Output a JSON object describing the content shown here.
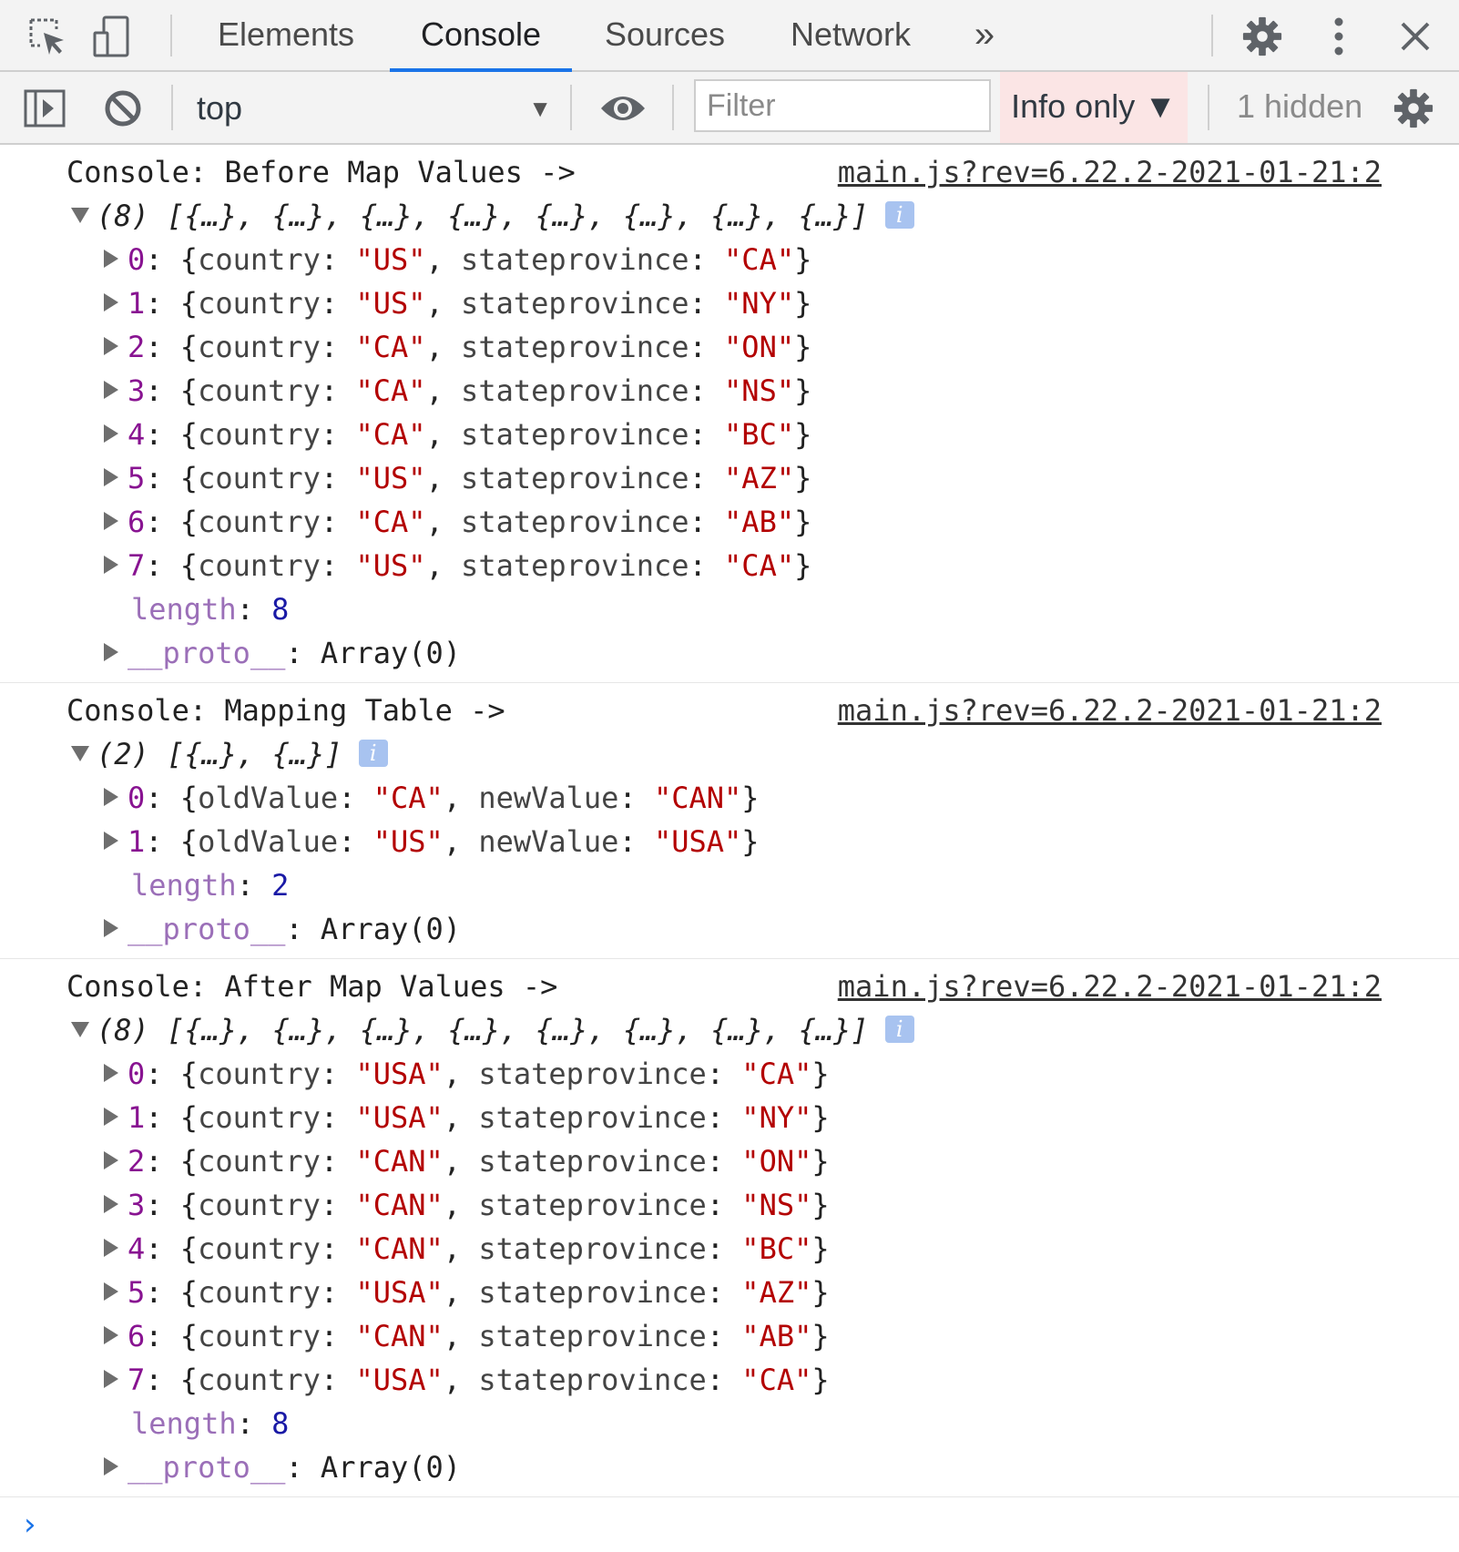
{
  "tabs": {
    "items": [
      "Elements",
      "Console",
      "Sources",
      "Network"
    ],
    "active": "Console",
    "more": "»"
  },
  "toolbar": {
    "context": "top",
    "filter_placeholder": "Filter",
    "levels": "Info only ▼",
    "hidden_count": "1 hidden"
  },
  "messages": [
    {
      "title": "Console: Before Map Values ->",
      "source": "main.js?rev=6.22.2-2021-01-21:2",
      "summary": "(8) [{…}, {…}, {…}, {…}, {…}, {…}, {…}, {…}]",
      "key_a": "country",
      "key_b": "stateprovince",
      "entries": [
        {
          "index": "0",
          "a": "US",
          "b": "CA"
        },
        {
          "index": "1",
          "a": "US",
          "b": "NY"
        },
        {
          "index": "2",
          "a": "CA",
          "b": "ON"
        },
        {
          "index": "3",
          "a": "CA",
          "b": "NS"
        },
        {
          "index": "4",
          "a": "CA",
          "b": "BC"
        },
        {
          "index": "5",
          "a": "US",
          "b": "AZ"
        },
        {
          "index": "6",
          "a": "CA",
          "b": "AB"
        },
        {
          "index": "7",
          "a": "US",
          "b": "CA"
        }
      ],
      "length_label": "length",
      "length": "8",
      "proto_label": "__proto__",
      "proto_value": "Array(0)"
    },
    {
      "title": "Console: Mapping Table ->",
      "source": "main.js?rev=6.22.2-2021-01-21:2",
      "summary": "(2) [{…}, {…}]",
      "key_a": "oldValue",
      "key_b": "newValue",
      "entries": [
        {
          "index": "0",
          "a": "CA",
          "b": "CAN"
        },
        {
          "index": "1",
          "a": "US",
          "b": "USA"
        }
      ],
      "length_label": "length",
      "length": "2",
      "proto_label": "__proto__",
      "proto_value": "Array(0)"
    },
    {
      "title": "Console: After Map Values ->",
      "source": "main.js?rev=6.22.2-2021-01-21:2",
      "summary": "(8) [{…}, {…}, {…}, {…}, {…}, {…}, {…}, {…}]",
      "key_a": "country",
      "key_b": "stateprovince",
      "entries": [
        {
          "index": "0",
          "a": "USA",
          "b": "CA"
        },
        {
          "index": "1",
          "a": "USA",
          "b": "NY"
        },
        {
          "index": "2",
          "a": "CAN",
          "b": "ON"
        },
        {
          "index": "3",
          "a": "CAN",
          "b": "NS"
        },
        {
          "index": "4",
          "a": "CAN",
          "b": "BC"
        },
        {
          "index": "5",
          "a": "USA",
          "b": "AZ"
        },
        {
          "index": "6",
          "a": "CAN",
          "b": "AB"
        },
        {
          "index": "7",
          "a": "USA",
          "b": "CA"
        }
      ],
      "length_label": "length",
      "length": "8",
      "proto_label": "__proto__",
      "proto_value": "Array(0)"
    }
  ],
  "colors": {
    "accent": "#1a73e8",
    "string": "#b30000",
    "index": "#881391",
    "number": "#1a1aa6"
  },
  "icons": [
    "inspect-element-icon",
    "device-toggle-icon",
    "more-tabs-icon",
    "settings-gear-icon",
    "kebab-menu-icon",
    "close-icon",
    "sidebar-toggle-icon",
    "clear-console-icon",
    "live-expression-eye-icon",
    "console-settings-gear-icon",
    "prompt-chevron-icon"
  ]
}
